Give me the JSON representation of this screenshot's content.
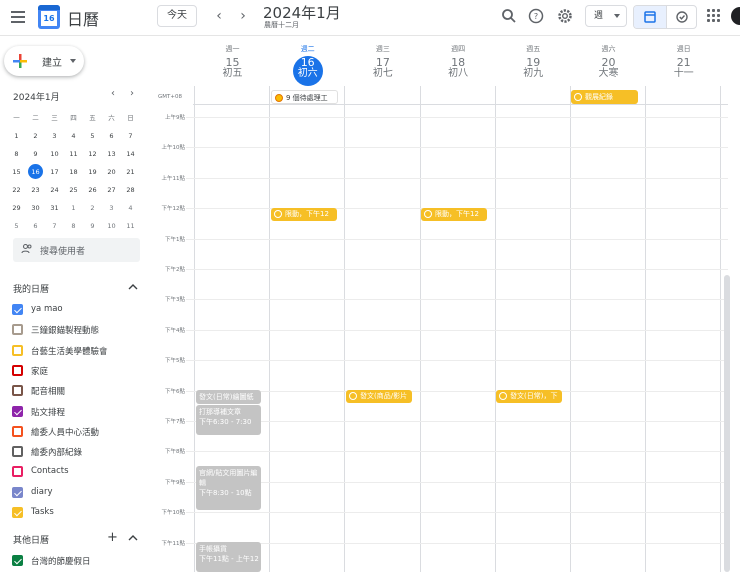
{
  "header": {
    "app_title": "日曆",
    "logo_num": "16",
    "today_label": "今天",
    "month_title": "2024年1月",
    "month_sub": "農曆十二月",
    "view_label": "週"
  },
  "sidebar": {
    "create_label": "建立",
    "mini_title": "2024年1月",
    "mini_weekdays": [
      "一",
      "二",
      "三",
      "四",
      "五",
      "六",
      "日"
    ],
    "mini_rows": [
      [
        "1",
        "2",
        "3",
        "4",
        "5",
        "6",
        "7"
      ],
      [
        "8",
        "9",
        "10",
        "11",
        "12",
        "13",
        "14"
      ],
      [
        "15",
        "16",
        "17",
        "18",
        "19",
        "20",
        "21"
      ],
      [
        "22",
        "23",
        "24",
        "25",
        "26",
        "27",
        "28"
      ],
      [
        "29",
        "30",
        "31",
        "1",
        "2",
        "3",
        "4"
      ],
      [
        "5",
        "6",
        "7",
        "8",
        "9",
        "10",
        "11"
      ]
    ],
    "search_people": "搜尋使用者",
    "my_calendars_title": "我的日曆",
    "my_calendars": [
      {
        "label": "ya mao",
        "color": "#4285f4",
        "checked": true
      },
      {
        "label": "三鐘銀錨製程動態",
        "color": "#a79b8e",
        "checked": false
      },
      {
        "label": "台藝生活美學體驗會",
        "color": "#f6bf26",
        "checked": false
      },
      {
        "label": "家庭",
        "color": "#d50000",
        "checked": false
      },
      {
        "label": "配音相關",
        "color": "#795548",
        "checked": false
      },
      {
        "label": "貼文排程",
        "color": "#8e24aa",
        "checked": true
      },
      {
        "label": "繪委人員中心活動",
        "color": "#f4511e",
        "checked": false
      },
      {
        "label": "繪委內部紀錄",
        "color": "#616161",
        "checked": false
      },
      {
        "label": "Contacts",
        "color": "#e91e63",
        "checked": false
      },
      {
        "label": "diary",
        "color": "#7986cb",
        "checked": true
      },
      {
        "label": "Tasks",
        "color": "#f6bf26",
        "checked": true
      }
    ],
    "other_calendars_title": "其他日曆",
    "other_calendars": [
      {
        "label": "台灣的節慶假日",
        "color": "#0b8043",
        "checked": true
      }
    ]
  },
  "week": {
    "gmt_label": "GMT+08",
    "days": [
      {
        "weekday": "週一",
        "date": "15",
        "lunar": "初五"
      },
      {
        "weekday": "週二",
        "date": "16",
        "lunar": "初六"
      },
      {
        "weekday": "週三",
        "date": "17",
        "lunar": "初七"
      },
      {
        "weekday": "週四",
        "date": "18",
        "lunar": "初八"
      },
      {
        "weekday": "週五",
        "date": "19",
        "lunar": "初九"
      },
      {
        "weekday": "週六",
        "date": "20",
        "lunar": "大寒"
      },
      {
        "weekday": "週日",
        "date": "21",
        "lunar": "十一"
      }
    ],
    "hours": [
      "上午9點",
      "上午10點",
      "上午11點",
      "下午12點",
      "下午1點",
      "下午2點",
      "下午3點",
      "下午4點",
      "下午5點",
      "下午6點",
      "下午7點",
      "下午8點",
      "下午9點",
      "下午10點",
      "下午11點"
    ]
  },
  "events": {
    "allday_task": "9 個待處理工",
    "allday_sat": "觀展紀錄",
    "task_tue_noon": "限動，下午12",
    "task_thu_noon": "限動，下午12",
    "task_wed_6pm": "發文(商品/影片",
    "task_fri_6pm": "發文(日常)，下",
    "mon_6pm_title": "發文(日常)繪圖紙",
    "mon_630_title": "打那導補文章",
    "mon_630_time": "下午6:30 - 7:30",
    "mon_830_title": "官網/貼文用圖片編輯",
    "mon_830_time": "下午8:30 - 10點",
    "mon_11_title": "手帳攝貨",
    "mon_11_time": "下午11點 - 上午12"
  }
}
